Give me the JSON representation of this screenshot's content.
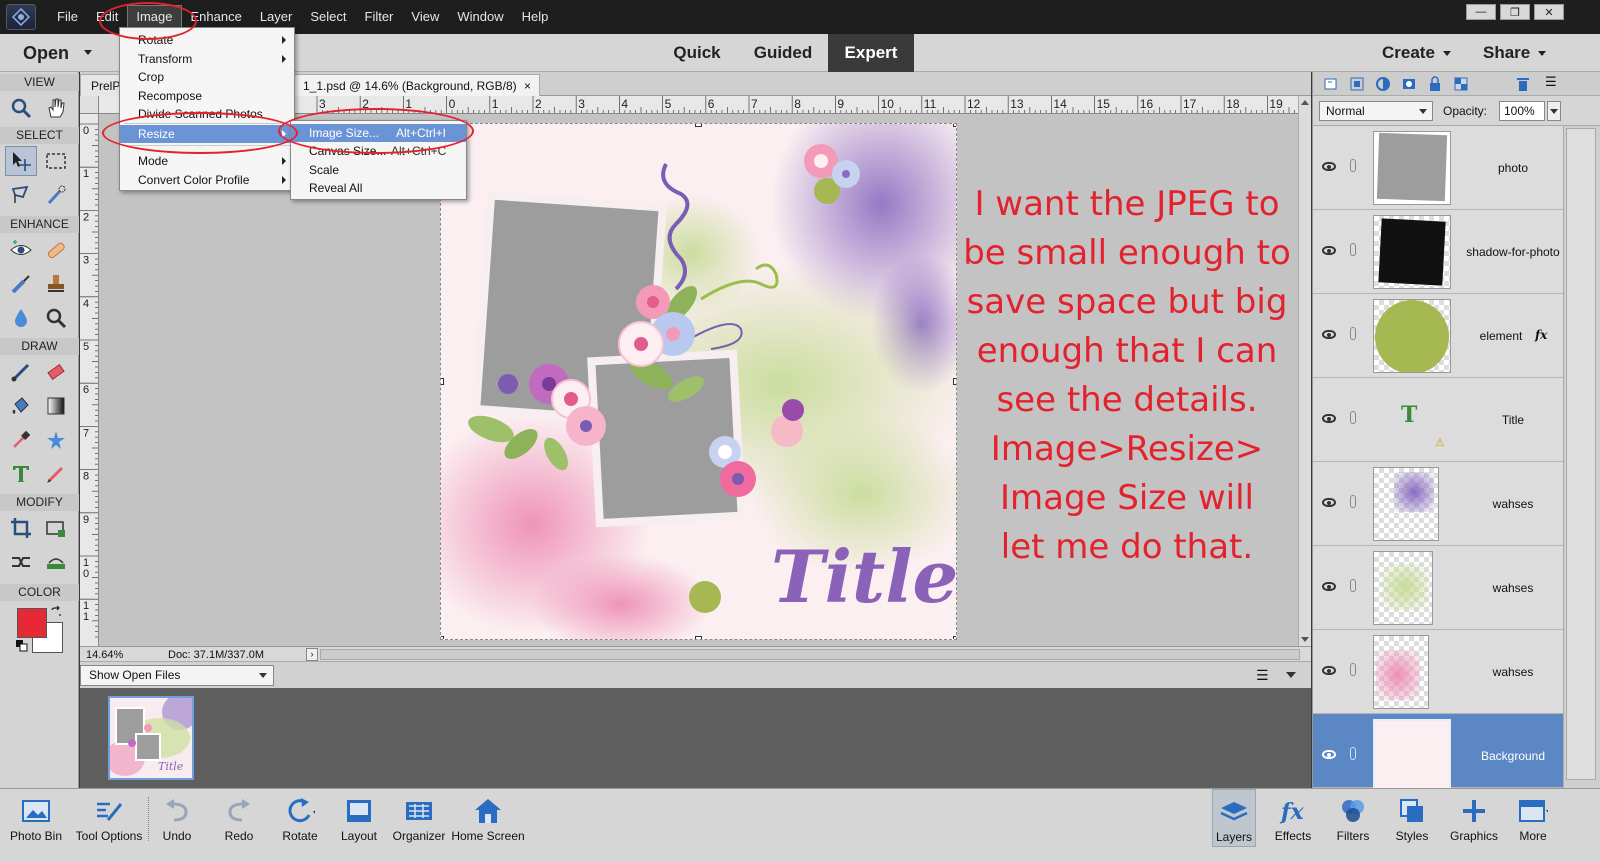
{
  "menubar": {
    "items": [
      "File",
      "Edit",
      "Image",
      "Enhance",
      "Layer",
      "Select",
      "Filter",
      "View",
      "Window",
      "Help"
    ],
    "active": "Image",
    "window_controls": [
      "—",
      "❐",
      "✕"
    ]
  },
  "modebar": {
    "open_label": "Open",
    "modes": [
      "Quick",
      "Guided",
      "Expert"
    ],
    "active_mode": "Expert",
    "create_label": "Create",
    "share_label": "Share"
  },
  "toolbox": {
    "sections": [
      "VIEW",
      "SELECT",
      "ENHANCE",
      "DRAW",
      "MODIFY",
      "COLOR"
    ],
    "foreground_color": "#e52a35",
    "background_color": "#ffffff"
  },
  "document": {
    "tab_partial": "PrelP",
    "tab_title": "1_1.psd @ 14.6% (Background, RGB/8)",
    "tab_close": "×",
    "zoom": "14.64%",
    "doc_info": "Doc: 37.1M/337.0M"
  },
  "image_menu": {
    "items": [
      {
        "label": "Rotate",
        "submenu": true
      },
      {
        "label": "Transform",
        "submenu": true
      },
      {
        "label": "Crop",
        "submenu": false
      },
      {
        "label": "Recompose",
        "submenu": false
      },
      {
        "label": "Divide Scanned Photos",
        "submenu": false
      },
      {
        "label": "Resize",
        "submenu": true
      },
      {
        "label": "Mode",
        "submenu": true
      },
      {
        "label": "Convert Color Profile",
        "submenu": true
      }
    ],
    "highlighted": "Resize"
  },
  "resize_submenu": {
    "items": [
      {
        "label": "Image Size...",
        "shortcut": "Alt+Ctrl+I"
      },
      {
        "label": "Canvas Size...",
        "shortcut": "Alt+Ctrl+C"
      },
      {
        "label": "Scale",
        "shortcut": ""
      },
      {
        "label": "Reveal All",
        "shortcut": ""
      }
    ],
    "highlighted": "Image Size..."
  },
  "annotation": {
    "lines": [
      "I want the JPEG to",
      "be small enough to",
      "save space but big",
      "enough that I can",
      "see the details.",
      "Image>Resize>",
      "Image Size will",
      "let me do that."
    ],
    "color": "#e3222d"
  },
  "artwork": {
    "title_text": "Title"
  },
  "photo_bin": {
    "dropdown": "Show Open Files",
    "thumb_title": "Title"
  },
  "layers_panel": {
    "blend_mode": "Normal",
    "opacity_label": "Opacity:",
    "opacity_value": "100%",
    "layers": [
      {
        "name": "photo",
        "selected": false,
        "fx": false
      },
      {
        "name": "shadow-for-photo",
        "selected": false,
        "fx": false
      },
      {
        "name": "element",
        "selected": false,
        "fx": true
      },
      {
        "name": "Title",
        "selected": false,
        "fx": false
      },
      {
        "name": "wahses",
        "selected": false,
        "fx": false
      },
      {
        "name": "wahses",
        "selected": false,
        "fx": false
      },
      {
        "name": "wahses",
        "selected": false,
        "fx": false
      },
      {
        "name": "Background",
        "selected": true,
        "fx": false
      }
    ],
    "fx_label": "fx",
    "text_layer_glyph": "T",
    "warning_glyph": "⚠"
  },
  "taskbar": {
    "left": [
      "Photo Bin",
      "Tool Options",
      "Undo",
      "Redo",
      "Rotate",
      "Layout",
      "Organizer",
      "Home Screen"
    ],
    "right": [
      "Layers",
      "Effects",
      "Filters",
      "Styles",
      "Graphics",
      "More"
    ],
    "active": "Layers"
  },
  "rulers": {
    "h_labels": [
      "3",
      "2",
      "1",
      "0",
      "1",
      "2",
      "3",
      "4",
      "5",
      "6",
      "7",
      "8",
      "9",
      "10",
      "11",
      "12",
      "13",
      "14",
      "15",
      "16",
      "17",
      "18",
      "19"
    ],
    "v_labels": [
      "0",
      "1",
      "2",
      "3",
      "4",
      "5",
      "6",
      "7",
      "8",
      "9",
      "1 0",
      "1 1"
    ]
  }
}
